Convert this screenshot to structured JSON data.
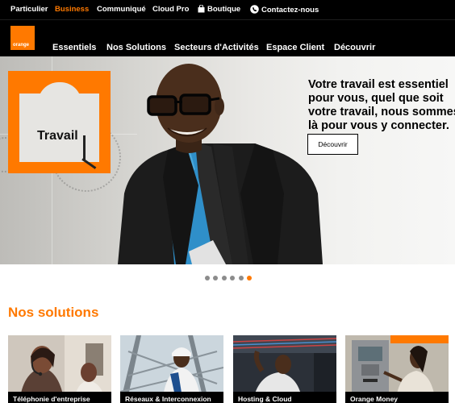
{
  "topbar": {
    "items": [
      {
        "label": "Particulier"
      },
      {
        "label": "Business"
      },
      {
        "label": "Communiqué"
      },
      {
        "label": "Cloud Pro"
      },
      {
        "label": "Boutique"
      },
      {
        "label": "Contactez-nous"
      }
    ]
  },
  "brand": {
    "logo_text": "orange",
    "accent": "#ff7900"
  },
  "nav": {
    "items": [
      {
        "label": "Essentiels"
      },
      {
        "label": "Nos Solutions"
      },
      {
        "label": "Secteurs d'Activités"
      },
      {
        "label": "Espace Client"
      },
      {
        "label": "Découvrir"
      }
    ]
  },
  "hero": {
    "tile_label": "Travail",
    "heading_lines": [
      "Votre travail est essentiel",
      "pour vous, quel que soit",
      "votre travail, nous sommes",
      "là pour vous y connecter."
    ],
    "button_label": "Découvrir"
  },
  "carousel": {
    "slide_count": 6,
    "active_index": 5
  },
  "solutions": {
    "title": "Nos solutions",
    "cards": [
      {
        "label": "Téléphonie d'entreprise"
      },
      {
        "label": "Réseaux & Interconnexion"
      },
      {
        "label": "Hosting & Cloud"
      },
      {
        "label": "Orange Money"
      }
    ]
  }
}
